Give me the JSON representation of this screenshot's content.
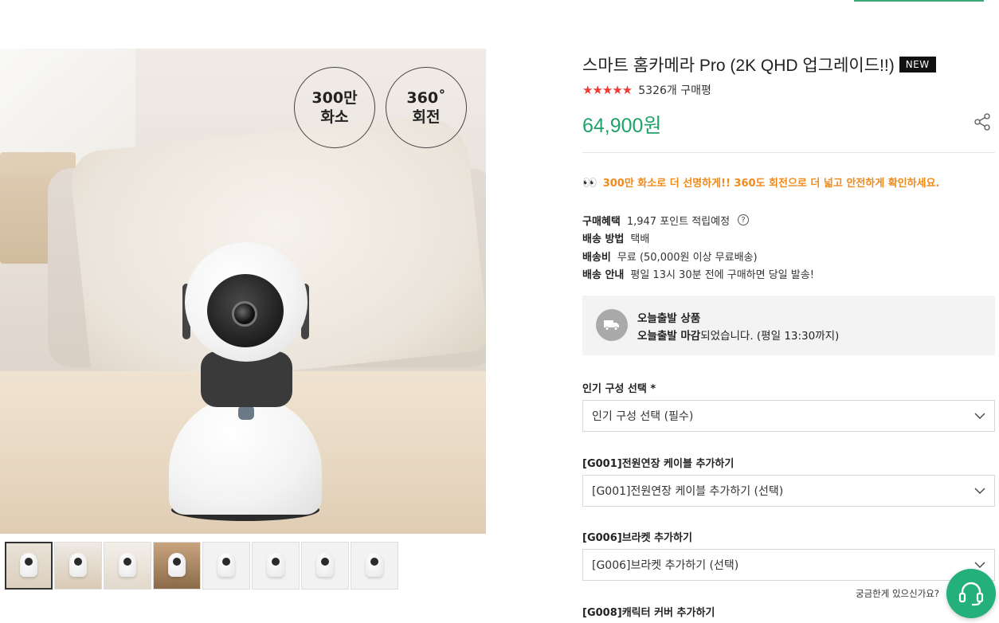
{
  "product": {
    "title": "스마트 홈카메라 Pro (2K QHD 업그레이드!!)",
    "new_badge": "NEW",
    "stars": "★★★★★",
    "review_count": "5326개 구매평",
    "price": "64,900원",
    "image_badges": [
      {
        "line1": "300만",
        "line2": "화소"
      },
      {
        "line1": "360˚",
        "line2": "회전"
      }
    ]
  },
  "promo": {
    "icon": "eyes-icon",
    "text": "300만 화소로 더 선명하게!! 360도 회전으로 더 넓고 안전하게 확인하세요."
  },
  "info": [
    {
      "label": "구매혜택",
      "value": "1,947 포인트 적립예정"
    },
    {
      "label": "배송 방법",
      "value": "택배"
    },
    {
      "label": "배송비",
      "value": "무료 (50,000원 이상 무료배송)"
    },
    {
      "label": "배송 안내",
      "value": "평일 13시 30분 전에 구매하면 당일 발송!"
    }
  ],
  "shipping": {
    "title": "오늘출발 상품",
    "sub_bold": "오늘출발 마감",
    "sub_rest": "되었습니다. (평일 13:30까지)"
  },
  "options": [
    {
      "label": "인기 구성 선택 *",
      "selected": "인기 구성 선택 (필수)"
    },
    {
      "label": "[G001]전원연장 케이블 추가하기",
      "selected": "[G001]전원연장 케이블 추가하기 (선택)"
    },
    {
      "label": "[G006]브라켓 추가하기",
      "selected": "[G006]브라켓 추가하기 (선택)"
    },
    {
      "label": "[G008]캐릭터 커버 추가하기",
      "selected": ""
    }
  ],
  "help": {
    "text": "궁금한게 있으신가요?"
  },
  "colors": {
    "price": "#1fa36a",
    "promo": "#f08a1c",
    "stars": "#ef3b34",
    "help_button": "#23b07a"
  }
}
